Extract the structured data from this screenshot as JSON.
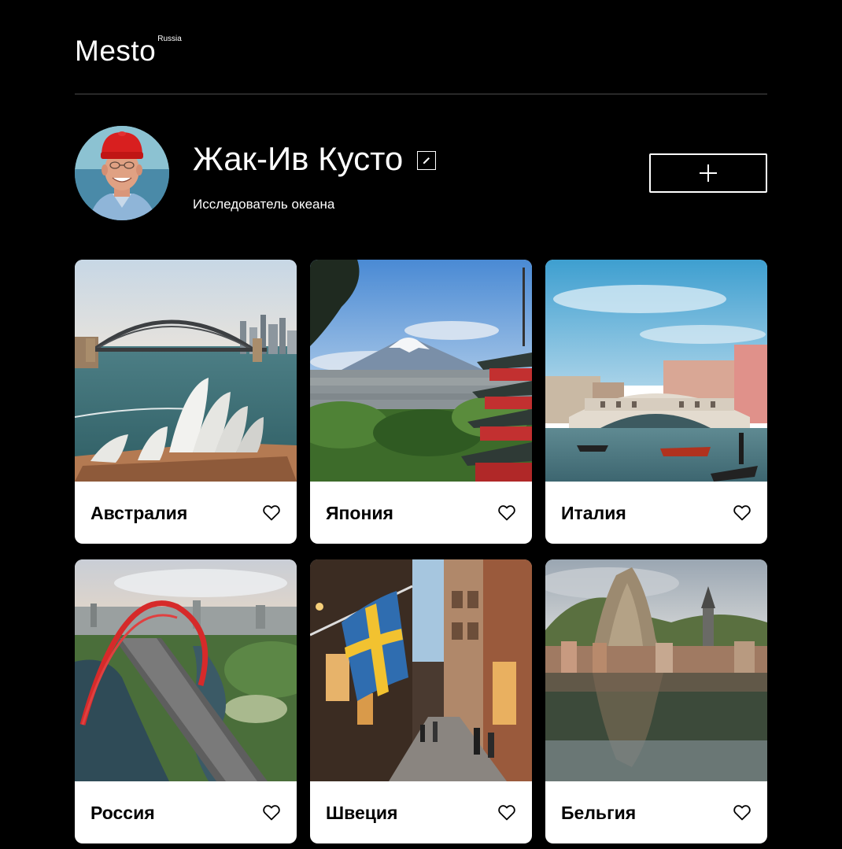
{
  "header": {
    "logo": "Mesto",
    "logo_region": "Russia"
  },
  "profile": {
    "name": "Жак-Ив Кусто",
    "about": "Исследователь океана",
    "edit_icon": "pencil-icon",
    "add_icon": "plus-icon"
  },
  "cards": [
    {
      "title": "Австралия",
      "image": "sydney-opera-house-harbour-bridge"
    },
    {
      "title": "Япония",
      "image": "mount-fuji-pagoda"
    },
    {
      "title": "Италия",
      "image": "venice-rialto-bridge"
    },
    {
      "title": "Россия",
      "image": "moscow-red-arch-bridge"
    },
    {
      "title": "Швеция",
      "image": "stockholm-street-swedish-flag"
    },
    {
      "title": "Бельгия",
      "image": "dinant-river-cliff"
    }
  ],
  "colors": {
    "background": "#000000",
    "card": "#ffffff",
    "divider": "#545454",
    "text_dark": "#000000",
    "text_light": "#ffffff"
  }
}
